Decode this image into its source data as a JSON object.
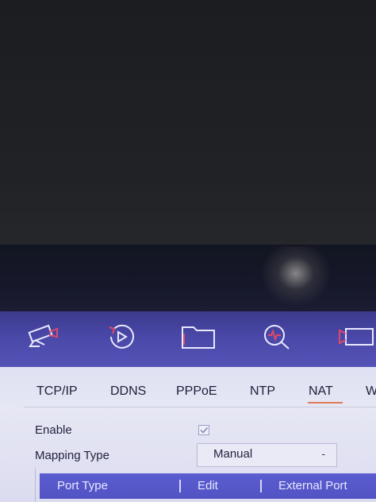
{
  "toolbar": {
    "icons": [
      "camera-icon",
      "playback-icon",
      "folder-icon",
      "search-icon",
      "video-camera-icon"
    ]
  },
  "tabs": [
    {
      "label": "TCP/IP"
    },
    {
      "label": "DDNS"
    },
    {
      "label": "PPPoE"
    },
    {
      "label": "NTP"
    },
    {
      "label": "NAT",
      "active": true
    },
    {
      "label": "W"
    }
  ],
  "form": {
    "enable_label": "Enable",
    "enable_checked": true,
    "mapping_type_label": "Mapping Type",
    "mapping_type_value": "Manual",
    "dropdown_arrow": "-"
  },
  "table": {
    "columns": [
      "Port Type",
      "Edit",
      "External Port"
    ]
  },
  "colors": {
    "toolbar": "#4a48a8",
    "active_tab_underline": "#e07a58",
    "table_header": "#5a5cd0",
    "icon_accent": "#e04a6a"
  }
}
